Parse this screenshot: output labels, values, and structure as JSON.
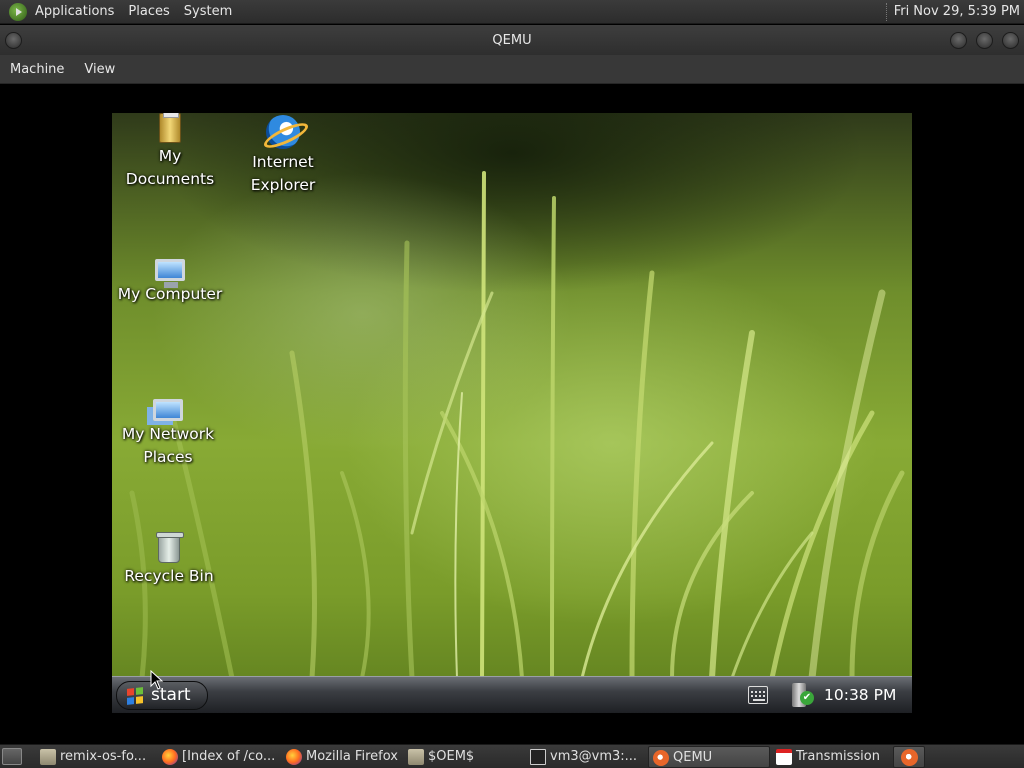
{
  "top_panel": {
    "menus": [
      "Applications",
      "Places",
      "System"
    ],
    "clock": "Fri Nov 29,  5:39 PM"
  },
  "qemu_window": {
    "title": "QEMU",
    "menus": [
      "Machine",
      "View"
    ]
  },
  "guest": {
    "desktop_icons": [
      {
        "label_line1": "My",
        "label_line2": "Documents",
        "icon": "my-documents-icon"
      },
      {
        "label_line1": "Internet",
        "label_line2": "Explorer",
        "icon": "internet-explorer-icon"
      },
      {
        "label_line1": "My Computer",
        "label_line2": "",
        "icon": "my-computer-icon"
      },
      {
        "label_line1": "My Network",
        "label_line2": "Places",
        "icon": "network-places-icon"
      },
      {
        "label_line1": "Recycle Bin",
        "label_line2": "",
        "icon": "recycle-bin-icon"
      }
    ],
    "taskbar": {
      "start_label": "start",
      "clock": "10:38 PM"
    }
  },
  "bottom_panel": {
    "tasks": [
      {
        "label": "remix-os-fo...",
        "icon": "folder-icon"
      },
      {
        "label": "[Index of /co...",
        "icon": "firefox-icon"
      },
      {
        "label": "Mozilla Firefox",
        "icon": "firefox-icon"
      },
      {
        "label": "$OEM$",
        "icon": "folder-icon"
      },
      {
        "label": "vm3@vm3:...",
        "icon": "terminal-icon"
      },
      {
        "label": "QEMU",
        "icon": "qemu-icon"
      },
      {
        "label": "Transmission",
        "icon": "transmission-icon"
      }
    ]
  },
  "colors": {
    "panel_bg": "#2e2e2e",
    "grass_green": "#88aa35",
    "guest_taskbar": "#3b3e43"
  }
}
